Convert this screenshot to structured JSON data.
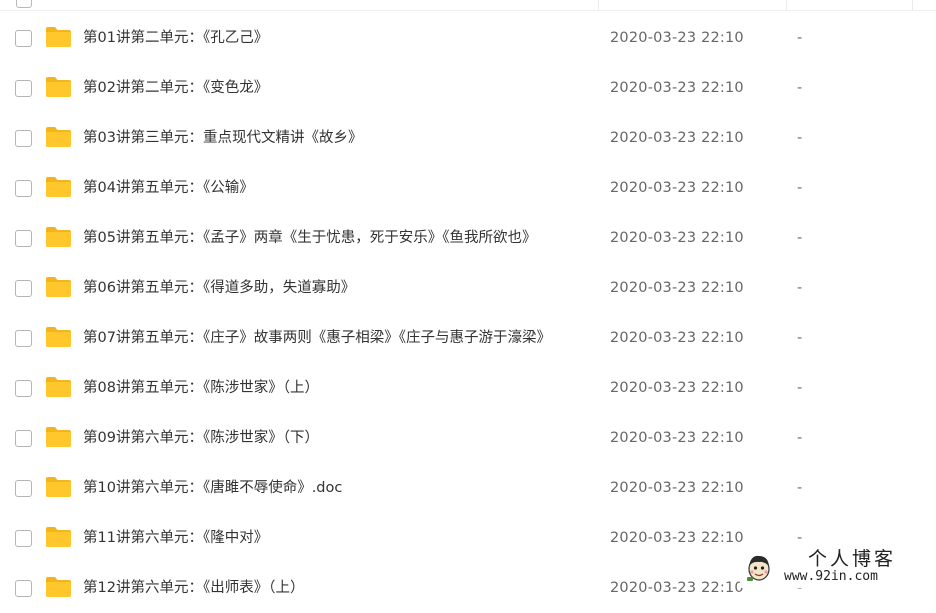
{
  "files": [
    {
      "name": "第01讲第二单元：《孔乙己》",
      "modified": "2020-03-23 22:10",
      "size": "-"
    },
    {
      "name": "第02讲第二单元：《变色龙》",
      "modified": "2020-03-23 22:10",
      "size": "-"
    },
    {
      "name": "第03讲第三单元：重点现代文精讲《故乡》",
      "modified": "2020-03-23 22:10",
      "size": "-"
    },
    {
      "name": "第04讲第五单元：《公输》",
      "modified": "2020-03-23 22:10",
      "size": "-"
    },
    {
      "name": "第05讲第五单元：《孟子》两章《生于忧患，死于安乐》《鱼我所欲也》",
      "modified": "2020-03-23 22:10",
      "size": "-"
    },
    {
      "name": "第06讲第五单元：《得道多助，失道寡助》",
      "modified": "2020-03-23 22:10",
      "size": "-"
    },
    {
      "name": "第07讲第五单元：《庄子》故事两则《惠子相梁》《庄子与惠子游于濠梁》",
      "modified": "2020-03-23 22:10",
      "size": "-"
    },
    {
      "name": "第08讲第五单元：《陈涉世家》（上）",
      "modified": "2020-03-23 22:10",
      "size": "-"
    },
    {
      "name": "第09讲第六单元：《陈涉世家》（下）",
      "modified": "2020-03-23 22:10",
      "size": "-"
    },
    {
      "name": "第10讲第六单元：《唐雎不辱使命》.doc",
      "modified": "2020-03-23 22:10",
      "size": "-"
    },
    {
      "name": "第11讲第六单元：《隆中对》",
      "modified": "2020-03-23 22:10",
      "size": "-"
    },
    {
      "name": "第12讲第六单元：《出师表》（上）",
      "modified": "2020-03-23 22:10",
      "size": "-"
    }
  ],
  "watermark": {
    "title": "个人博客",
    "url": "www.92in.com"
  },
  "colors": {
    "folder": "#FFC72C",
    "folder_dark": "#F2B51B",
    "text": "#333333",
    "muted": "#666666"
  },
  "icons": {
    "folder": "folder-icon",
    "checkbox": "checkbox",
    "logo": "blog-logo-icon"
  }
}
